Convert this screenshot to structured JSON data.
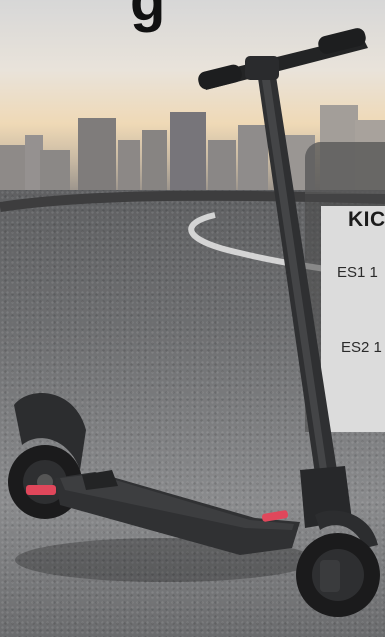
{
  "hero": {
    "headline": "g"
  },
  "info_panel": {
    "title": "KIC",
    "models": [
      {
        "label": "ES1 1"
      },
      {
        "label": "ES2 1"
      }
    ]
  },
  "colors": {
    "scooter_body": "#2b2c2e",
    "scooter_accent": "#e0475b",
    "panel": "#dcdcdc"
  }
}
